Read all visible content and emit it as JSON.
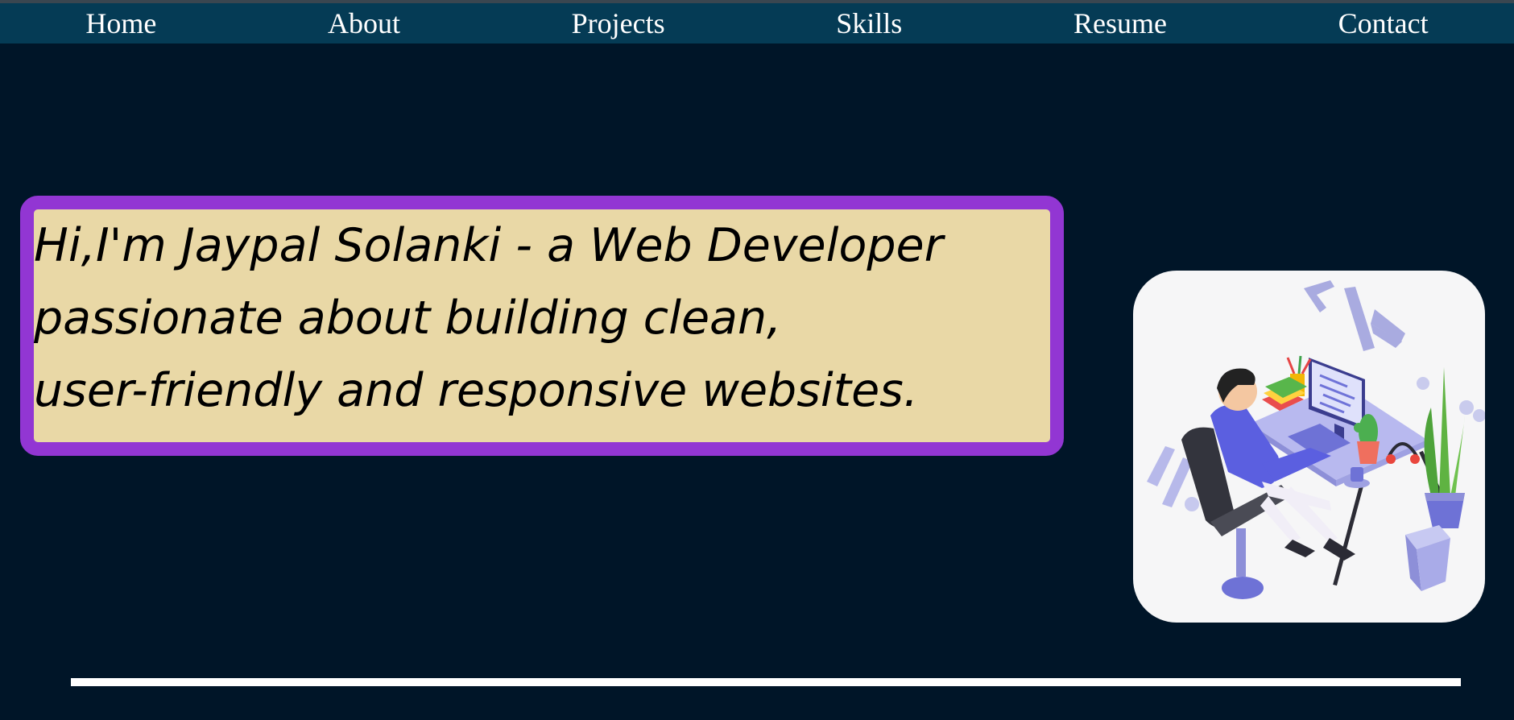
{
  "nav": {
    "items": [
      {
        "label": "Home"
      },
      {
        "label": "About"
      },
      {
        "label": "Projects"
      },
      {
        "label": "Skills"
      },
      {
        "label": "Resume"
      },
      {
        "label": "Contact"
      }
    ]
  },
  "hero": {
    "lines": [
      "Hi,I'm Jaypal Solanki - a Web Developer",
      "passionate about building clean,",
      "user-friendly and responsive websites."
    ]
  },
  "illustration": {
    "icon": "developer-at-desk-illustration",
    "code_symbol": "</>"
  },
  "colors": {
    "page_background": "#001528",
    "nav_background": "#053b55",
    "hero_background": "#e9d8a6",
    "hero_border": "#9236d3",
    "card_background": "#f6f6f7",
    "divider": "#ffffff"
  }
}
